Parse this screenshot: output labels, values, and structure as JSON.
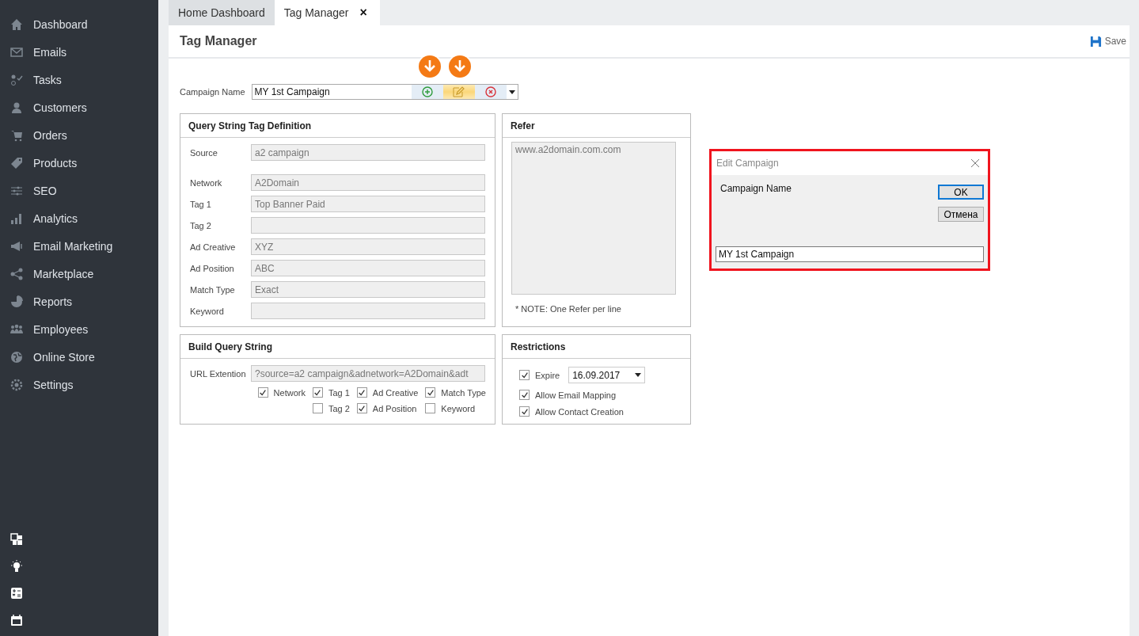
{
  "sidebar": {
    "items": [
      {
        "label": "Dashboard"
      },
      {
        "label": "Emails"
      },
      {
        "label": "Tasks"
      },
      {
        "label": "Customers"
      },
      {
        "label": "Orders"
      },
      {
        "label": "Products"
      },
      {
        "label": "SEO"
      },
      {
        "label": "Analytics"
      },
      {
        "label": "Email Marketing"
      },
      {
        "label": "Marketplace"
      },
      {
        "label": "Reports"
      },
      {
        "label": "Employees"
      },
      {
        "label": "Online Store"
      },
      {
        "label": "Settings"
      }
    ]
  },
  "tabs": [
    {
      "label": "Home Dashboard",
      "selected": false
    },
    {
      "label": "Tag Manager",
      "selected": true,
      "close": "×"
    }
  ],
  "page": {
    "title": "Tag Manager",
    "save": "Save"
  },
  "campaign": {
    "label": "Campaign Name",
    "value": "MY 1st Campaign"
  },
  "query_definition": {
    "title": "Query String Tag Definition",
    "fields": [
      {
        "label": "Source",
        "value": "a2 campaign"
      },
      {
        "label": "Network",
        "value": "A2Domain"
      },
      {
        "label": "Tag 1",
        "value": "Top Banner Paid"
      },
      {
        "label": "Tag 2"
      },
      {
        "label": "Ad Creative",
        "value": "XYZ"
      },
      {
        "label": "Ad Position",
        "value": "ABC"
      },
      {
        "label": "Match Type",
        "value": "Exact"
      },
      {
        "label": "Keyword"
      }
    ]
  },
  "refer": {
    "title": "Refer",
    "value": "www.a2domain.com.com",
    "note": "* NOTE: One Refer per line"
  },
  "build_query": {
    "title": "Build Query String",
    "url_label": "URL Extention",
    "url_value": "?source=a2 campaign&adnetwork=A2Domain&adt",
    "options": [
      {
        "label": "Network",
        "checked": true
      },
      {
        "label": "Tag 1",
        "checked": true
      },
      {
        "label": "Ad Creative",
        "checked": true
      },
      {
        "label": "Match Type",
        "checked": true
      },
      {
        "label": "Tag 2",
        "checked": false
      },
      {
        "label": "Ad Position",
        "checked": true
      },
      {
        "label": "Keyword",
        "checked": false
      }
    ]
  },
  "restrictions": {
    "title": "Restrictions",
    "items": [
      {
        "kind": "date",
        "label": "Expire",
        "checked": true,
        "value": "16.09.2017"
      },
      {
        "kind": "check",
        "label": "Allow Email Mapping",
        "checked": true
      },
      {
        "kind": "check",
        "label": "Allow Contact Creation",
        "checked": true
      }
    ]
  },
  "dialog": {
    "title": "Edit Campaign",
    "label": "Campaign Name",
    "ok": "OK",
    "cancel": "Отмена",
    "value": "MY 1st Campaign"
  }
}
